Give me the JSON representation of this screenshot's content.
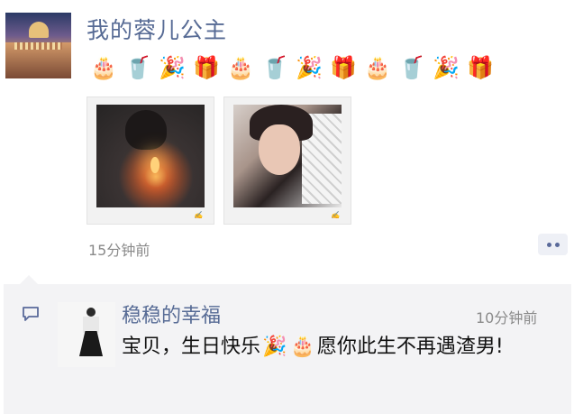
{
  "post": {
    "author": "我的蓉儿公主",
    "emoji": [
      {
        "icon": "birthday-cake-icon",
        "glyph": "🎂",
        "kind": "cake"
      },
      {
        "icon": "drink-cup-icon",
        "glyph": "🥤",
        "kind": "drink"
      },
      {
        "icon": "party-popper-icon",
        "glyph": "🎉",
        "kind": "party"
      },
      {
        "icon": "gift-box-icon",
        "glyph": "🎁",
        "kind": "gift"
      },
      {
        "icon": "birthday-cake-icon",
        "glyph": "🎂",
        "kind": "cake"
      },
      {
        "icon": "drink-cup-icon",
        "glyph": "🥤",
        "kind": "drink"
      },
      {
        "icon": "party-popper-icon",
        "glyph": "🎉",
        "kind": "party"
      },
      {
        "icon": "gift-box-icon",
        "glyph": "🎁",
        "kind": "gift"
      },
      {
        "icon": "birthday-cake-icon",
        "glyph": "🎂",
        "kind": "cake"
      },
      {
        "icon": "drink-cup-icon",
        "glyph": "🥤",
        "kind": "drink"
      },
      {
        "icon": "party-popper-icon",
        "glyph": "🎉",
        "kind": "party"
      },
      {
        "icon": "gift-box-icon",
        "glyph": "🎁",
        "kind": "gift"
      }
    ],
    "time": "15分钟前"
  },
  "comment": {
    "author": "稳稳的幸福",
    "time": "10分钟前",
    "text_before": "宝贝，生日快乐",
    "emoji": [
      "🎉",
      "🎂"
    ],
    "text_after": "愿你此生不再遇渣男!"
  },
  "colors": {
    "link": "#576b95",
    "meta": "#8a8a8a",
    "comment_bg": "#f3f3f5"
  }
}
